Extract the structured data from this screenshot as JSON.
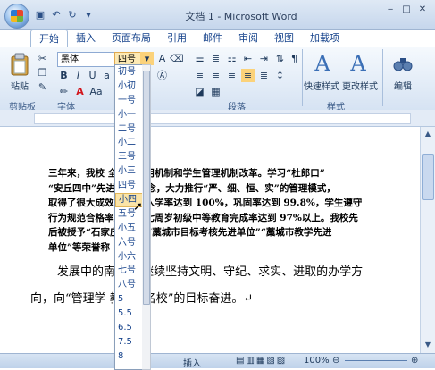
{
  "window": {
    "title": "文档 1 - Microsoft Word",
    "controls": [
      "‒",
      "□",
      "✕"
    ]
  },
  "tabs": [
    {
      "label": "开始",
      "active": true
    },
    {
      "label": "插入"
    },
    {
      "label": "页面布局"
    },
    {
      "label": "引用"
    },
    {
      "label": "邮件"
    },
    {
      "label": "审阅"
    },
    {
      "label": "视图"
    },
    {
      "label": "加载项"
    }
  ],
  "ribbon": {
    "clipboard_label": "剪贴板",
    "paste_label": "粘贴",
    "font_name": "黑体",
    "font_size": "四号",
    "font_group_label": "字体",
    "paragraph_label": "段落",
    "styles_label": "样式",
    "quick_styles": "快速样式",
    "change_styles": "更改样式",
    "edit_label": "编辑",
    "styles_glyph": "A"
  },
  "font_size_dropdown": {
    "items": [
      "初号",
      "小初",
      "一号",
      "小一",
      "二号",
      "小二",
      "三号",
      "小三",
      "四号",
      "小四",
      "五号",
      "小五",
      "六号",
      "小六",
      "七号",
      "八号",
      "5",
      "5.5",
      "6.5",
      "7.5",
      "8"
    ],
    "selected_index": 9
  },
  "document": {
    "paragraph1_lines": [
      "三年来，我校        全教师任用机制和学生管理机制改革。学习“杜郎口”",
      "“安丘四中”先进       教学理念，大力推行“严、细、恒、实”的管理模式，",
      "取得了很大成效。      学生入学率达到 100%，巩固率达到 99.8%，学生遵守",
      "行为规范合格率为     ，十七周岁初级中等教育完成率达到 97%以上。我校先",
      "后被授予“石家庄       学校”“藁城市目标考核先进单位”“藁城市教学先进",
      "单位”等荣誉称"
    ],
    "paragraph2_lines": [
      "发展中的南        学将继续坚持文明、守纪、求实、进取的办学方",
      "向，向“管理学         教学创名校”的目标奋进。↵"
    ]
  },
  "statusbar": {
    "mode": "插入",
    "zoom": "100%"
  },
  "colors": {
    "ribbon_blue": "#15428b",
    "highlight": "#fbe4a7"
  }
}
